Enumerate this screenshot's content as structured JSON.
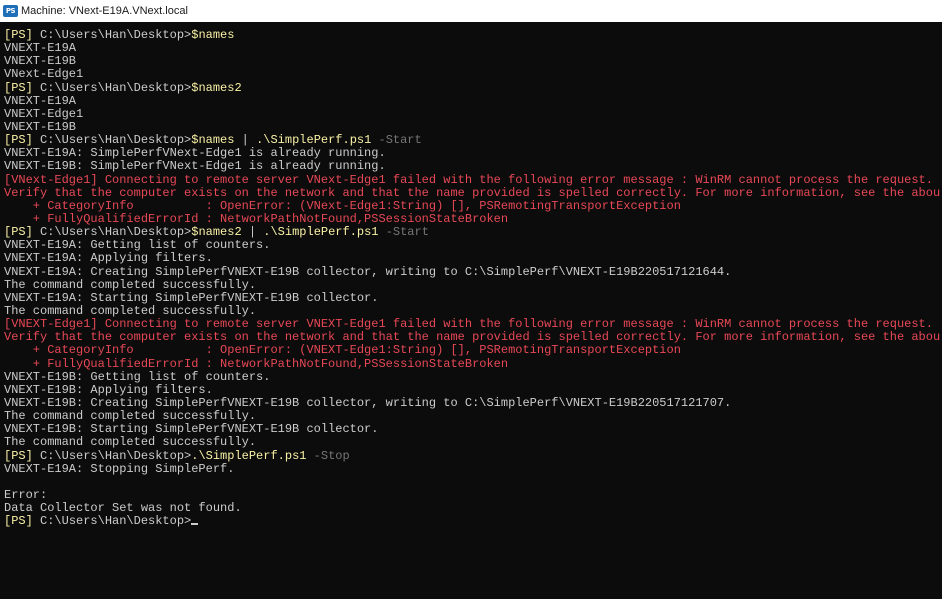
{
  "window": {
    "title": "Machine: VNext-E19A.VNext.local",
    "icon": "powershell-icon"
  },
  "colors": {
    "background": "#0c0c0c",
    "text": "#cccccc",
    "command": "#f9f1a5",
    "parameter": "#767676",
    "error": "#e74856"
  },
  "console": {
    "lines": [
      {
        "kind": "prompt",
        "segments": [
          {
            "c": "y",
            "t": "[PS]"
          },
          {
            "c": "w",
            "t": " C:\\Users\\Han\\Desktop>"
          },
          {
            "c": "y",
            "t": "$names"
          }
        ]
      },
      {
        "kind": "output",
        "segments": [
          {
            "c": "w",
            "t": "VNEXT-E19A"
          }
        ]
      },
      {
        "kind": "output",
        "segments": [
          {
            "c": "w",
            "t": "VNEXT-E19B"
          }
        ]
      },
      {
        "kind": "output",
        "segments": [
          {
            "c": "w",
            "t": "VNext-Edge1"
          }
        ]
      },
      {
        "kind": "prompt",
        "segments": [
          {
            "c": "y",
            "t": "[PS]"
          },
          {
            "c": "w",
            "t": " C:\\Users\\Han\\Desktop>"
          },
          {
            "c": "y",
            "t": "$names2"
          }
        ]
      },
      {
        "kind": "output",
        "segments": [
          {
            "c": "w",
            "t": "VNEXT-E19A"
          }
        ]
      },
      {
        "kind": "output",
        "segments": [
          {
            "c": "w",
            "t": "VNEXT-Edge1"
          }
        ]
      },
      {
        "kind": "output",
        "segments": [
          {
            "c": "w",
            "t": "VNEXT-E19B"
          }
        ]
      },
      {
        "kind": "prompt",
        "segments": [
          {
            "c": "y",
            "t": "[PS]"
          },
          {
            "c": "w",
            "t": " C:\\Users\\Han\\Desktop>"
          },
          {
            "c": "y",
            "t": "$names"
          },
          {
            "c": "w",
            "t": " | "
          },
          {
            "c": "y",
            "t": ".\\SimplePerf.ps1"
          },
          {
            "c": "g",
            "t": " -Start"
          }
        ]
      },
      {
        "kind": "output",
        "segments": [
          {
            "c": "w",
            "t": "VNEXT-E19A: SimplePerfVNext-Edge1 is already running."
          }
        ]
      },
      {
        "kind": "output",
        "segments": [
          {
            "c": "w",
            "t": "VNEXT-E19B: SimplePerfVNext-Edge1 is already running."
          }
        ]
      },
      {
        "kind": "error",
        "segments": [
          {
            "c": "r",
            "t": "[VNext-Edge1] Connecting to remote server VNext-Edge1 failed with the following error message : WinRM cannot process the request."
          }
        ]
      },
      {
        "kind": "error",
        "segments": [
          {
            "c": "r",
            "t": "Verify that the computer exists on the network and that the name provided is spelled correctly. For more information, see the abou"
          }
        ]
      },
      {
        "kind": "error",
        "segments": [
          {
            "c": "r",
            "t": "    + CategoryInfo          : OpenError: (VNext-Edge1:String) [], PSRemotingTransportException"
          }
        ]
      },
      {
        "kind": "error",
        "segments": [
          {
            "c": "r",
            "t": "    + FullyQualifiedErrorId : NetworkPathNotFound,PSSessionStateBroken"
          }
        ]
      },
      {
        "kind": "prompt",
        "segments": [
          {
            "c": "y",
            "t": "[PS]"
          },
          {
            "c": "w",
            "t": " C:\\Users\\Han\\Desktop>"
          },
          {
            "c": "y",
            "t": "$names2"
          },
          {
            "c": "w",
            "t": " | "
          },
          {
            "c": "y",
            "t": ".\\SimplePerf.ps1"
          },
          {
            "c": "g",
            "t": " -Start"
          }
        ]
      },
      {
        "kind": "output",
        "segments": [
          {
            "c": "w",
            "t": "VNEXT-E19A: Getting list of counters."
          }
        ]
      },
      {
        "kind": "output",
        "segments": [
          {
            "c": "w",
            "t": "VNEXT-E19A: Applying filters."
          }
        ]
      },
      {
        "kind": "output",
        "segments": [
          {
            "c": "w",
            "t": "VNEXT-E19A: Creating SimplePerfVNEXT-E19B collector, writing to C:\\SimplePerf\\VNEXT-E19B220517121644."
          }
        ]
      },
      {
        "kind": "output",
        "segments": [
          {
            "c": "w",
            "t": "The command completed successfully."
          }
        ]
      },
      {
        "kind": "output",
        "segments": [
          {
            "c": "w",
            "t": "VNEXT-E19A: Starting SimplePerfVNEXT-E19B collector."
          }
        ]
      },
      {
        "kind": "output",
        "segments": [
          {
            "c": "w",
            "t": "The command completed successfully."
          }
        ]
      },
      {
        "kind": "error",
        "segments": [
          {
            "c": "r",
            "t": "[VNEXT-Edge1] Connecting to remote server VNEXT-Edge1 failed with the following error message : WinRM cannot process the request."
          }
        ]
      },
      {
        "kind": "error",
        "segments": [
          {
            "c": "r",
            "t": "Verify that the computer exists on the network and that the name provided is spelled correctly. For more information, see the abou"
          }
        ]
      },
      {
        "kind": "error",
        "segments": [
          {
            "c": "r",
            "t": "    + CategoryInfo          : OpenError: (VNEXT-Edge1:String) [], PSRemotingTransportException"
          }
        ]
      },
      {
        "kind": "error",
        "segments": [
          {
            "c": "r",
            "t": "    + FullyQualifiedErrorId : NetworkPathNotFound,PSSessionStateBroken"
          }
        ]
      },
      {
        "kind": "output",
        "segments": [
          {
            "c": "w",
            "t": "VNEXT-E19B: Getting list of counters."
          }
        ]
      },
      {
        "kind": "output",
        "segments": [
          {
            "c": "w",
            "t": "VNEXT-E19B: Applying filters."
          }
        ]
      },
      {
        "kind": "output",
        "segments": [
          {
            "c": "w",
            "t": "VNEXT-E19B: Creating SimplePerfVNEXT-E19B collector, writing to C:\\SimplePerf\\VNEXT-E19B220517121707."
          }
        ]
      },
      {
        "kind": "output",
        "segments": [
          {
            "c": "w",
            "t": "The command completed successfully."
          }
        ]
      },
      {
        "kind": "output",
        "segments": [
          {
            "c": "w",
            "t": "VNEXT-E19B: Starting SimplePerfVNEXT-E19B collector."
          }
        ]
      },
      {
        "kind": "output",
        "segments": [
          {
            "c": "w",
            "t": "The command completed successfully."
          }
        ]
      },
      {
        "kind": "prompt",
        "segments": [
          {
            "c": "y",
            "t": "[PS]"
          },
          {
            "c": "w",
            "t": " C:\\Users\\Han\\Desktop>"
          },
          {
            "c": "y",
            "t": ".\\SimplePerf.ps1"
          },
          {
            "c": "g",
            "t": " -Stop"
          }
        ]
      },
      {
        "kind": "output",
        "segments": [
          {
            "c": "w",
            "t": "VNEXT-E19A: Stopping SimplePerf."
          }
        ]
      },
      {
        "kind": "blank",
        "segments": []
      },
      {
        "kind": "output",
        "segments": [
          {
            "c": "w",
            "t": "Error:"
          }
        ]
      },
      {
        "kind": "output",
        "segments": [
          {
            "c": "w",
            "t": "Data Collector Set was not found."
          }
        ]
      },
      {
        "kind": "current-prompt",
        "segments": [
          {
            "c": "y",
            "t": "[PS]"
          },
          {
            "c": "w",
            "t": " C:\\Users\\Han\\Desktop>"
          }
        ]
      }
    ]
  }
}
